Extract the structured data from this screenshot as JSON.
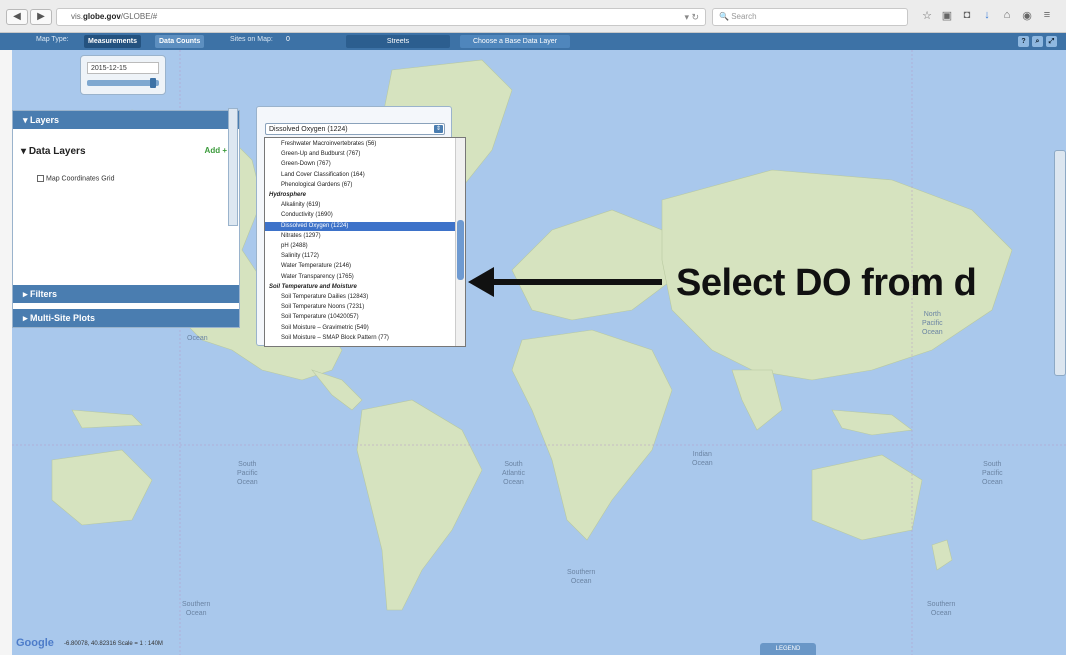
{
  "browser": {
    "url_prefix": "vis.",
    "url_host": "globe.gov",
    "url_path": "/GLOBE/#",
    "search_placeholder": "Search"
  },
  "header": {
    "map_type_label": "Map Type:",
    "tab_measurements": "Measurements",
    "tab_data_counts": "Data Counts",
    "sites_on_map_label": "Sites on Map:",
    "sites_on_map_value": "0",
    "streets_label": "Streets",
    "base_layer_label": "Choose a Base Data Layer"
  },
  "date": {
    "value": "2015-12-15",
    "slider_level": 0.95
  },
  "panel": {
    "layers_title": "Layers",
    "data_layers_title": "Data Layers",
    "add_label": "Add +",
    "map_coordinates_grid": "Map Coordinates Grid",
    "filters_title": "Filters",
    "multisite_title": "Multi-Site Plots"
  },
  "dropdown": {
    "selected_value": "Dissolved Oxygen (1224)",
    "items": [
      {
        "label": "Freshwater Macroinvertebrates (56)",
        "type": "item"
      },
      {
        "label": "Green-Up and Budburst (767)",
        "type": "item"
      },
      {
        "label": "Green-Down (767)",
        "type": "item"
      },
      {
        "label": "Land Cover Classification (164)",
        "type": "item"
      },
      {
        "label": "Phenological Gardens (67)",
        "type": "item"
      },
      {
        "label": "Hydrosphere",
        "type": "group"
      },
      {
        "label": "Alkalinity (619)",
        "type": "item"
      },
      {
        "label": "Conductivity (1690)",
        "type": "item"
      },
      {
        "label": "Dissolved Oxygen (1224)",
        "type": "selected"
      },
      {
        "label": "Nitrates (1297)",
        "type": "item"
      },
      {
        "label": "pH (2488)",
        "type": "item"
      },
      {
        "label": "Salinity (1172)",
        "type": "item"
      },
      {
        "label": "Water Temperature (2146)",
        "type": "item"
      },
      {
        "label": "Water Transparency (1765)",
        "type": "item"
      },
      {
        "label": "Soil Temperature and Moisture",
        "type": "group"
      },
      {
        "label": "Soil Temperature Dailies (12843)",
        "type": "item"
      },
      {
        "label": "Soil Temperature Noons (7231)",
        "type": "item"
      },
      {
        "label": "Soil Temperature (10420057)",
        "type": "item"
      },
      {
        "label": "Soil Moisture – Gravimetric (549)",
        "type": "item"
      },
      {
        "label": "Soil Moisture – SMAP Block Pattern (77)",
        "type": "item"
      }
    ]
  },
  "annotation": {
    "text": "Select DO from d"
  },
  "map": {
    "ocean_labels": {
      "south_pacific": "South\nPacific\nOcean",
      "south_atlantic": "South\nAtlantic\nOcean",
      "indian": "Indian\nOcean",
      "south_pacific_right": "South\nPacific\nOcean",
      "north_pacific_right": "North\nPacific\nOcean",
      "southern_left": "Southern\nOcean",
      "southern_mid": "Southern\nOcean",
      "southern_right": "Southern\nOcean",
      "ocean_left": "Ocean"
    },
    "land_color": "#d6e3bf",
    "water_color": "#a9c8ec"
  },
  "footer": {
    "google": "Google",
    "coords": "-6.80078, 40.82316 Scale = 1 : 140M",
    "legend": "LEGEND"
  }
}
